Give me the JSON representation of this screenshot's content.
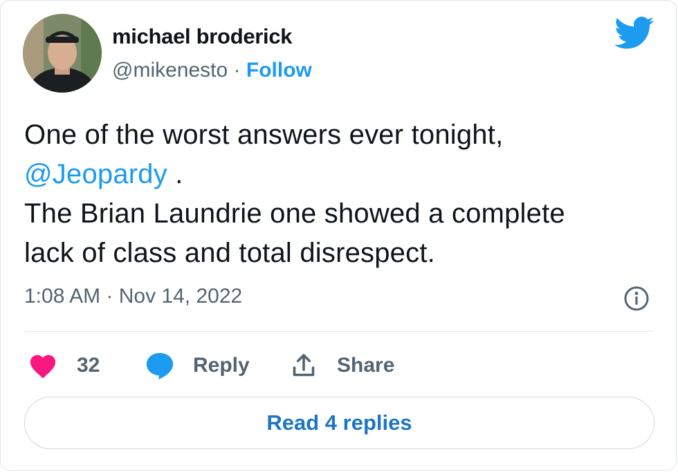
{
  "author": {
    "name": "michael broderick",
    "handle": "@mikenesto",
    "separator": "·",
    "follow_label": "Follow"
  },
  "icons": {
    "brand": "twitter-bird-icon",
    "info": "info-icon",
    "like": "heart-icon",
    "reply": "speech-bubble-icon",
    "share": "share-arrow-icon"
  },
  "tweet": {
    "line1": "One of the worst answers ever tonight,",
    "mention": "@Jeopardy",
    "mention_suffix": " .",
    "line3": "The Brian Laundrie one showed a complete",
    "line4": "lack of class and total disrespect."
  },
  "timestamp": "1:08 AM · Nov 14, 2022",
  "actions": {
    "likes_count": "32",
    "reply_label": "Reply",
    "share_label": "Share"
  },
  "read_replies_label": "Read 4 replies",
  "colors": {
    "accent": "#1d9bf0",
    "like": "#f91880",
    "muted": "#536471",
    "text": "#0f1419"
  }
}
